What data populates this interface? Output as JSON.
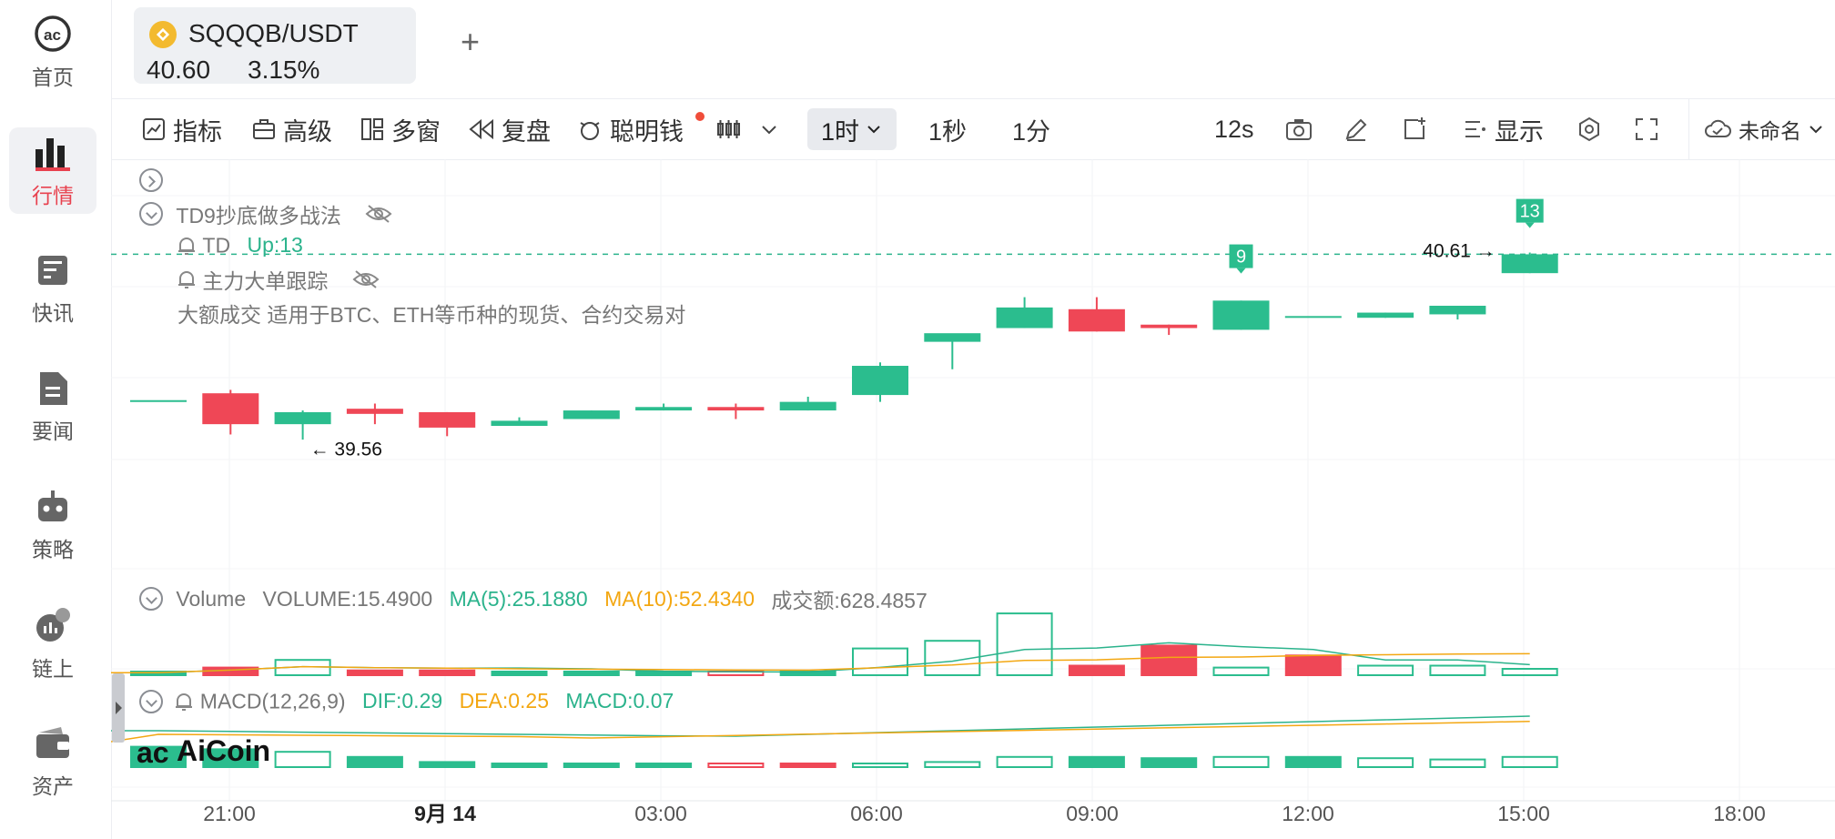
{
  "sidebar": {
    "items": [
      {
        "label": "首页",
        "icon": "aicoin-logo-icon"
      },
      {
        "label": "行情",
        "icon": "bar-chart-icon",
        "active": true
      },
      {
        "label": "快讯",
        "icon": "newsflash-icon"
      },
      {
        "label": "要闻",
        "icon": "document-icon"
      },
      {
        "label": "策略",
        "icon": "robot-icon"
      },
      {
        "label": "链上",
        "icon": "onchain-icon"
      },
      {
        "label": "资产",
        "icon": "wallet-icon"
      }
    ]
  },
  "tab": {
    "pair": "SQQQB/USDT",
    "price": "40.60",
    "change": "3.15%"
  },
  "toolbar": {
    "indicator": "指标",
    "advanced": "高级",
    "multi_window": "多窗",
    "replay": "复盘",
    "smart_money": "聪明钱",
    "interval_active": "1时",
    "interval_1s": "1秒",
    "interval_1m": "1分",
    "countdown": "12s",
    "display": "显示",
    "layout_name": "未命名"
  },
  "indicators": {
    "td9_name": "TD9抄底做多战法",
    "td_label": "TD",
    "td_value": "Up:13",
    "whale_name": "主力大单跟踪",
    "whale_desc": "大额成交 适用于BTC、ETH等币种的现货、合约交易对"
  },
  "volume_legend": {
    "name": "Volume",
    "volume": "VOLUME:15.4900",
    "ma5": "MA(5):25.1880",
    "ma10": "MA(10):52.4340",
    "turnover": "成交额:628.4857"
  },
  "macd_legend": {
    "name": "MACD(12,26,9)",
    "dif": "DIF:0.29",
    "dea": "DEA:0.25",
    "macd": "MACD:0.07"
  },
  "annotations": {
    "low_label": "← 39.56",
    "last_label": "40.61 →",
    "td_9": "9",
    "td_13": "13"
  },
  "watermark": "AiCoin",
  "colors": {
    "up": "#2bbd8e",
    "down": "#ef4756",
    "ma5": "#2bb38c",
    "ma10": "#f3a712"
  },
  "chart_data": {
    "type": "candlestick",
    "x_labels": [
      "21:00",
      "9月 14",
      "03:00",
      "06:00",
      "09:00",
      "12:00",
      "15:00",
      "18:00"
    ],
    "price_line": 40.61,
    "candles": [
      {
        "o": 39.76,
        "h": 39.76,
        "l": 39.76,
        "c": 39.76
      },
      {
        "o": 39.8,
        "h": 39.82,
        "l": 39.56,
        "c": 39.62
      },
      {
        "o": 39.62,
        "h": 39.7,
        "l": 39.53,
        "c": 39.69
      },
      {
        "o": 39.71,
        "h": 39.74,
        "l": 39.62,
        "c": 39.68
      },
      {
        "o": 39.69,
        "h": 39.69,
        "l": 39.55,
        "c": 39.6
      },
      {
        "o": 39.61,
        "h": 39.66,
        "l": 39.61,
        "c": 39.64
      },
      {
        "o": 39.65,
        "h": 39.7,
        "l": 39.65,
        "c": 39.7
      },
      {
        "o": 39.7,
        "h": 39.74,
        "l": 39.7,
        "c": 39.72
      },
      {
        "o": 39.72,
        "h": 39.74,
        "l": 39.65,
        "c": 39.7
      },
      {
        "o": 39.7,
        "h": 39.78,
        "l": 39.7,
        "c": 39.75
      },
      {
        "o": 39.79,
        "h": 39.98,
        "l": 39.75,
        "c": 39.96
      },
      {
        "o": 40.1,
        "h": 40.13,
        "l": 39.94,
        "c": 40.15
      },
      {
        "o": 40.18,
        "h": 40.36,
        "l": 40.18,
        "c": 40.3
      },
      {
        "o": 40.29,
        "h": 40.36,
        "l": 40.16,
        "c": 40.16
      },
      {
        "o": 40.2,
        "h": 40.2,
        "l": 40.14,
        "c": 40.18
      },
      {
        "o": 40.17,
        "h": 40.34,
        "l": 40.17,
        "c": 40.34
      },
      {
        "o": 40.25,
        "h": 40.25,
        "l": 40.25,
        "c": 40.25
      },
      {
        "o": 40.24,
        "h": 40.27,
        "l": 40.24,
        "c": 40.27
      },
      {
        "o": 40.26,
        "h": 40.31,
        "l": 40.23,
        "c": 40.31
      },
      {
        "o": 40.5,
        "h": 40.62,
        "l": 40.5,
        "c": 40.61
      }
    ],
    "volume": [
      0.8,
      2.4,
      4.8,
      1.5,
      1.5,
      1.1,
      1.1,
      1.1,
      0.6,
      1.1,
      8.4,
      10.8,
      19.4,
      3.0,
      9.3,
      2.4,
      6.2,
      3.0,
      3.0,
      2.0
    ],
    "volume_up": [
      true,
      false,
      true,
      false,
      false,
      true,
      true,
      true,
      false,
      true,
      true,
      true,
      true,
      false,
      false,
      true,
      false,
      true,
      true,
      true
    ],
    "volume_hollow": [
      false,
      false,
      true,
      false,
      false,
      false,
      false,
      false,
      true,
      false,
      true,
      true,
      true,
      false,
      false,
      true,
      false,
      true,
      true,
      true
    ],
    "macd_hist": [
      -0.08,
      -0.07,
      -0.06,
      -0.04,
      -0.02,
      -0.01,
      -0.01,
      0.0,
      0.005,
      0.005,
      -0.01,
      -0.02,
      -0.04,
      -0.04,
      -0.035,
      -0.04,
      -0.04,
      -0.035,
      -0.03,
      -0.04
    ]
  }
}
